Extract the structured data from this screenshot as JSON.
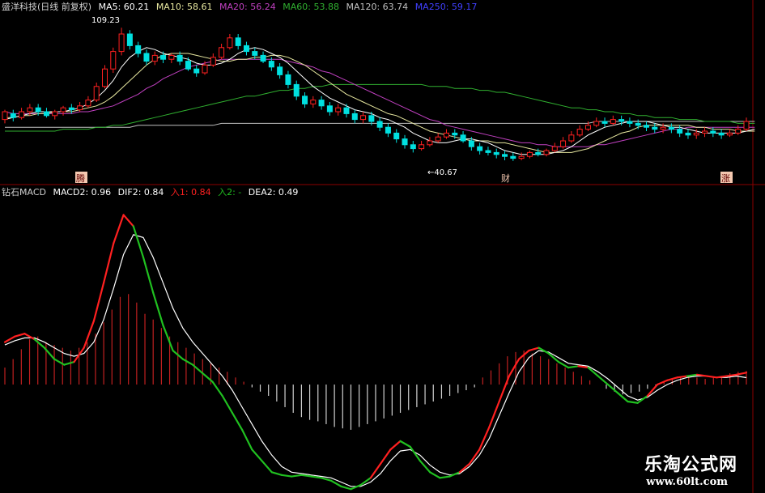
{
  "colors": {
    "up": "#ff2020",
    "down": "#00e0e0",
    "ma5": "#ffffff",
    "ma10": "#e8e8a0",
    "ma20": "#c040c0",
    "ma60": "#30b030",
    "ma120": "#c0c0c0",
    "ma250": "#4040ff",
    "dif_red": "#ff2020",
    "dif_green": "#20c020",
    "dea": "#ffffff",
    "divider": "#8b0000"
  },
  "upper_legend": {
    "title": "盛洋科技(日线 前复权)",
    "ma5": "MA5: 60.21",
    "ma10": "MA10: 58.61",
    "ma20": "MA20: 56.24",
    "ma60": "MA60: 53.88",
    "ma120": "MA120: 63.74",
    "ma250": "MA250: 59.17"
  },
  "lower_legend": {
    "title": "钻石MACD",
    "macd2": "MACD2: 0.96",
    "dif2": "DIF2: 0.84",
    "in1": "入1: 0.84",
    "in2": "入2: -",
    "dea2": "DEA2: 0.49"
  },
  "annotations": {
    "high_price": "109.23",
    "low_price": "←40.67",
    "marker_1": "腾",
    "marker_2": "财",
    "marker_3": "涨"
  },
  "watermark": {
    "name": "乐淘公式网",
    "url": "www.60lt.com"
  },
  "chart_data": [
    {
      "type": "candlestick",
      "note_price_high": 109.23,
      "note_price_low": 40.67,
      "ylim": [
        36,
        116
      ],
      "candles": [
        [
          62,
          66,
          60,
          67,
          1
        ],
        [
          65,
          63,
          61,
          67,
          0
        ],
        [
          63,
          66,
          62,
          68,
          1
        ],
        [
          66,
          68,
          64,
          70,
          1
        ],
        [
          68,
          66,
          64,
          70,
          0
        ],
        [
          66,
          64,
          63,
          68,
          0
        ],
        [
          64,
          66,
          62,
          67,
          1
        ],
        [
          66,
          68,
          64,
          69,
          1
        ],
        [
          68,
          67,
          65,
          70,
          0
        ],
        [
          67,
          69,
          66,
          71,
          1
        ],
        [
          69,
          72,
          68,
          74,
          1
        ],
        [
          72,
          79,
          71,
          81,
          1
        ],
        [
          79,
          88,
          78,
          90,
          1
        ],
        [
          88,
          97,
          86,
          99,
          1
        ],
        [
          97,
          106,
          95,
          109.23,
          1
        ],
        [
          106,
          100,
          98,
          108,
          0
        ],
        [
          100,
          96,
          94,
          102,
          0
        ],
        [
          96,
          92,
          90,
          98,
          0
        ],
        [
          92,
          95,
          90,
          97,
          1
        ],
        [
          95,
          93,
          91,
          97,
          0
        ],
        [
          93,
          95,
          91,
          96,
          1
        ],
        [
          95,
          92,
          90,
          97,
          0
        ],
        [
          92,
          88,
          87,
          94,
          0
        ],
        [
          88,
          86,
          84,
          90,
          0
        ],
        [
          86,
          90,
          85,
          92,
          1
        ],
        [
          90,
          94,
          89,
          96,
          1
        ],
        [
          94,
          99,
          93,
          101,
          1
        ],
        [
          99,
          104,
          98,
          106,
          1
        ],
        [
          104,
          100,
          98,
          106,
          0
        ],
        [
          100,
          97,
          95,
          102,
          0
        ],
        [
          97,
          95,
          93,
          99,
          0
        ],
        [
          95,
          92,
          91,
          97,
          0
        ],
        [
          92,
          89,
          87,
          94,
          0
        ],
        [
          89,
          85,
          83,
          91,
          0
        ],
        [
          85,
          80,
          78,
          87,
          0
        ],
        [
          80,
          74,
          72,
          82,
          0
        ],
        [
          74,
          70,
          68,
          76,
          0
        ],
        [
          70,
          72,
          68,
          74,
          1
        ],
        [
          72,
          69,
          67,
          74,
          0
        ],
        [
          69,
          66,
          64,
          71,
          0
        ],
        [
          66,
          68,
          64,
          70,
          1
        ],
        [
          68,
          65,
          63,
          70,
          0
        ],
        [
          65,
          62,
          60,
          67,
          0
        ],
        [
          62,
          64,
          60,
          66,
          1
        ],
        [
          64,
          61,
          59,
          66,
          0
        ],
        [
          61,
          58,
          56,
          63,
          0
        ],
        [
          58,
          55,
          53,
          60,
          0
        ],
        [
          55,
          52,
          50,
          57,
          0
        ],
        [
          52,
          49,
          47,
          54,
          0
        ],
        [
          49,
          47,
          45,
          51,
          0
        ],
        [
          47,
          49,
          46,
          51,
          1
        ],
        [
          49,
          51,
          48,
          53,
          1
        ],
        [
          51,
          53,
          50,
          55,
          1
        ],
        [
          53,
          55,
          52,
          57,
          1
        ],
        [
          55,
          54,
          52,
          57,
          0
        ],
        [
          54,
          51,
          50,
          56,
          0
        ],
        [
          51,
          48,
          46,
          53,
          0
        ],
        [
          48,
          46,
          44,
          50,
          0
        ],
        [
          46,
          45,
          43.5,
          48,
          0
        ],
        [
          45,
          44,
          42,
          47,
          0
        ],
        [
          44,
          43,
          41,
          46,
          0
        ],
        [
          43,
          42,
          40.67,
          45,
          0
        ],
        [
          42,
          43,
          41,
          45,
          1
        ],
        [
          43,
          45,
          42,
          46,
          1
        ],
        [
          45,
          44,
          43,
          47,
          0
        ],
        [
          44,
          46,
          43,
          47,
          1
        ],
        [
          46,
          48,
          45,
          50,
          1
        ],
        [
          48,
          51,
          47,
          53,
          1
        ],
        [
          51,
          54,
          50,
          56,
          1
        ],
        [
          54,
          57,
          53,
          59,
          1
        ],
        [
          57,
          59,
          56,
          61,
          1
        ],
        [
          59,
          61,
          58,
          63,
          1
        ],
        [
          61,
          60,
          58,
          63,
          0
        ],
        [
          60,
          62,
          59,
          64,
          1
        ],
        [
          62,
          61,
          59,
          64,
          0
        ],
        [
          61,
          60,
          58,
          63,
          0
        ],
        [
          60,
          59,
          57,
          62,
          0
        ],
        [
          59,
          58,
          56,
          61,
          0
        ],
        [
          58,
          57,
          55,
          60,
          0
        ],
        [
          57,
          58,
          55,
          60,
          1
        ],
        [
          58,
          57,
          55,
          60,
          0
        ],
        [
          57,
          55,
          53,
          59,
          0
        ],
        [
          55,
          54,
          52,
          57,
          0
        ],
        [
          54,
          55,
          52,
          57,
          1
        ],
        [
          55,
          56,
          53,
          58,
          1
        ],
        [
          56,
          55,
          53,
          58,
          0
        ],
        [
          55,
          54,
          52,
          57,
          0
        ],
        [
          54,
          55,
          53,
          57,
          1
        ],
        [
          55,
          57,
          54,
          59,
          1
        ],
        [
          57,
          61,
          56,
          63,
          1
        ]
      ],
      "ma5": [
        62,
        63,
        64,
        65,
        66,
        66,
        66,
        66,
        67,
        68,
        70,
        73,
        77,
        82,
        89,
        94,
        97,
        99,
        98,
        96,
        95,
        94,
        93,
        91,
        90,
        90,
        91,
        93,
        96,
        98,
        99,
        98,
        96,
        94,
        91,
        87,
        83,
        79,
        76,
        73,
        71,
        69,
        67,
        66,
        65,
        63,
        62,
        60,
        58,
        55,
        53,
        51,
        50,
        50,
        51,
        52,
        52,
        51,
        50,
        48,
        46,
        45,
        44,
        44,
        44,
        44,
        45,
        46,
        48,
        51,
        54,
        56,
        58,
        59,
        60,
        61,
        61,
        61,
        60,
        59,
        58,
        58,
        57,
        56,
        55,
        55,
        55,
        55,
        55,
        56,
        57
      ],
      "ma10": [
        63,
        63,
        64,
        64,
        65,
        65,
        66,
        66,
        66,
        67,
        68,
        69,
        71,
        74,
        78,
        82,
        86,
        90,
        93,
        95,
        96,
        96,
        96,
        95,
        94,
        93,
        92,
        92,
        93,
        93,
        94,
        94,
        95,
        95,
        94,
        92,
        90,
        87,
        84,
        81,
        78,
        75,
        73,
        71,
        69,
        67,
        65,
        64,
        62,
        60,
        58,
        56,
        55,
        54,
        53,
        52,
        51,
        51,
        51,
        50,
        50,
        49,
        48,
        47,
        46,
        45,
        45,
        45,
        45,
        46,
        47,
        49,
        51,
        53,
        55,
        56,
        58,
        59,
        59,
        59,
        59,
        59,
        59,
        58,
        58,
        57,
        57,
        57,
        56,
        56,
        56
      ],
      "ma20": [
        66,
        65,
        65,
        65,
        65,
        65,
        65,
        65,
        65,
        66,
        66,
        67,
        68,
        69,
        71,
        73,
        75,
        78,
        80,
        83,
        85,
        87,
        89,
        90,
        91,
        92,
        93,
        93,
        93,
        93,
        93,
        93,
        93,
        93,
        92,
        91,
        90,
        89,
        87,
        86,
        84,
        82,
        80,
        78,
        76,
        74,
        72,
        70,
        68,
        66,
        64,
        62,
        61,
        59,
        58,
        57,
        56,
        55,
        54,
        53,
        52,
        51,
        50,
        50,
        49,
        49,
        48,
        48,
        48,
        48,
        48,
        49,
        49,
        50,
        51,
        52,
        53,
        54,
        55,
        56,
        57,
        57,
        58,
        58,
        58,
        58,
        58,
        58,
        58,
        58,
        58
      ],
      "ma60": [
        56,
        56,
        56,
        56,
        56,
        56,
        56,
        57,
        57,
        57,
        57,
        58,
        58,
        59,
        59,
        60,
        61,
        62,
        63,
        64,
        65,
        66,
        67,
        68,
        69,
        70,
        71,
        72,
        73,
        74,
        74,
        75,
        76,
        77,
        77,
        78,
        78,
        79,
        79,
        80,
        80,
        80,
        80,
        80,
        80,
        80,
        80,
        80,
        80,
        80,
        80,
        79,
        79,
        79,
        78,
        78,
        78,
        77,
        77,
        76,
        76,
        75,
        74,
        73,
        72,
        71,
        70,
        69,
        68,
        68,
        67,
        67,
        66,
        66,
        65,
        65,
        64,
        64,
        63,
        63,
        63,
        62,
        62,
        62,
        61,
        61,
        61,
        61,
        60,
        60,
        60
      ],
      "ma120": [
        58,
        58,
        58,
        58,
        58,
        58,
        58,
        58,
        58,
        58,
        58,
        58,
        58,
        58,
        58,
        58,
        59,
        59,
        59,
        59,
        59,
        59,
        59,
        59,
        59,
        59,
        60,
        60,
        60,
        60,
        60,
        60,
        60,
        60,
        60,
        60,
        60,
        60,
        60,
        60,
        60,
        60,
        60,
        60,
        60,
        60,
        60,
        60,
        60,
        60,
        60,
        60,
        60,
        60,
        60,
        60,
        60,
        60,
        60,
        60,
        60,
        60,
        60,
        60,
        60,
        60,
        60,
        60,
        60,
        60,
        60,
        61,
        61,
        61,
        61,
        61,
        61,
        61,
        61,
        61,
        61,
        61,
        61,
        61,
        61,
        61,
        61,
        61,
        61,
        61,
        61
      ]
    },
    {
      "type": "bar",
      "title": "钻石MACD",
      "ylim": [
        -7.5,
        13
      ],
      "histogram": [
        1.2,
        1.8,
        2.5,
        3.2,
        3.4,
        3.0,
        2.8,
        2.6,
        2.4,
        2.6,
        3.0,
        3.6,
        4.4,
        5.3,
        6.2,
        6.4,
        5.8,
        5.0,
        4.6,
        4.0,
        3.4,
        3.0,
        2.6,
        2.2,
        1.8,
        1.5,
        1.2,
        0.9,
        0.5,
        0.2,
        -0.2,
        -0.5,
        -0.8,
        -1.2,
        -1.6,
        -2.0,
        -2.3,
        -2.5,
        -2.6,
        -2.8,
        -3.0,
        -3.1,
        -3.2,
        -3.0,
        -2.8,
        -2.6,
        -2.4,
        -2.2,
        -2.0,
        -1.8,
        -1.6,
        -1.4,
        -1.2,
        -1.0,
        -0.8,
        -0.6,
        -0.4,
        -0.2,
        0.5,
        1.0,
        1.5,
        2.0,
        2.3,
        2.4,
        2.2,
        2.0,
        1.8,
        1.5,
        1.2,
        0.9,
        0.6,
        0.3,
        0.0,
        -0.3,
        -0.5,
        -0.7,
        -0.6,
        -0.5,
        -0.3,
        -0.1,
        0.2,
        0.4,
        0.5,
        0.6,
        0.5,
        0.4,
        0.5,
        0.6,
        0.8,
        0.9,
        0.96
      ],
      "dif": [
        3.0,
        3.4,
        3.6,
        3.2,
        2.6,
        1.8,
        1.4,
        1.6,
        2.6,
        4.5,
        7.2,
        10.0,
        12.0,
        11.2,
        9.0,
        6.5,
        4.2,
        2.4,
        1.8,
        1.4,
        0.8,
        0.2,
        -0.8,
        -2.0,
        -3.2,
        -4.6,
        -5.4,
        -6.2,
        -6.4,
        -6.5,
        -6.4,
        -6.5,
        -6.6,
        -6.8,
        -7.2,
        -7.4,
        -7.1,
        -6.6,
        -5.6,
        -4.6,
        -4.0,
        -4.4,
        -5.4,
        -6.2,
        -6.6,
        -6.5,
        -6.2,
        -5.6,
        -4.6,
        -3.0,
        -1.2,
        0.6,
        1.8,
        2.4,
        2.6,
        2.2,
        1.6,
        1.2,
        1.3,
        1.2,
        0.6,
        0.0,
        -0.6,
        -1.2,
        -1.3,
        -0.8,
        0.0,
        0.3,
        0.5,
        0.6,
        0.7,
        0.6,
        0.5,
        0.6,
        0.7,
        0.84
      ],
      "dif_color": [
        "r",
        "r",
        "r",
        "g",
        "g",
        "g",
        "g",
        "r",
        "r",
        "r",
        "r",
        "r",
        "r",
        "g",
        "g",
        "g",
        "g",
        "g",
        "g",
        "g",
        "g",
        "g",
        "g",
        "g",
        "g",
        "g",
        "g",
        "g",
        "g",
        "g",
        "g",
        "g",
        "g",
        "g",
        "g",
        "g",
        "g",
        "r",
        "r",
        "r",
        "g",
        "g",
        "g",
        "g",
        "g",
        "g",
        "r",
        "r",
        "r",
        "r",
        "r",
        "r",
        "r",
        "r",
        "g",
        "g",
        "g",
        "g",
        "r",
        "g",
        "g",
        "g",
        "g",
        "g",
        "g",
        "r",
        "r",
        "r",
        "r",
        "g",
        "r",
        "r",
        "r",
        "r",
        "r",
        "r"
      ],
      "dea": [
        2.8,
        3.1,
        3.3,
        3.3,
        3.0,
        2.6,
        2.2,
        2.0,
        2.2,
        3.0,
        4.6,
        6.8,
        9.2,
        10.6,
        10.4,
        9.0,
        7.2,
        5.4,
        4.0,
        3.0,
        2.2,
        1.4,
        0.6,
        -0.4,
        -1.6,
        -2.8,
        -4.0,
        -5.0,
        -5.8,
        -6.2,
        -6.3,
        -6.4,
        -6.5,
        -6.6,
        -6.9,
        -7.2,
        -7.2,
        -6.9,
        -6.3,
        -5.4,
        -4.7,
        -4.6,
        -5.0,
        -5.7,
        -6.2,
        -6.4,
        -6.3,
        -5.8,
        -5.0,
        -3.8,
        -2.2,
        -0.6,
        0.9,
        1.9,
        2.4,
        2.3,
        1.9,
        1.5,
        1.4,
        1.3,
        0.9,
        0.4,
        -0.2,
        -0.8,
        -1.1,
        -0.9,
        -0.4,
        0.0,
        0.3,
        0.5,
        0.6,
        0.6,
        0.5,
        0.5,
        0.6,
        0.49
      ]
    }
  ]
}
